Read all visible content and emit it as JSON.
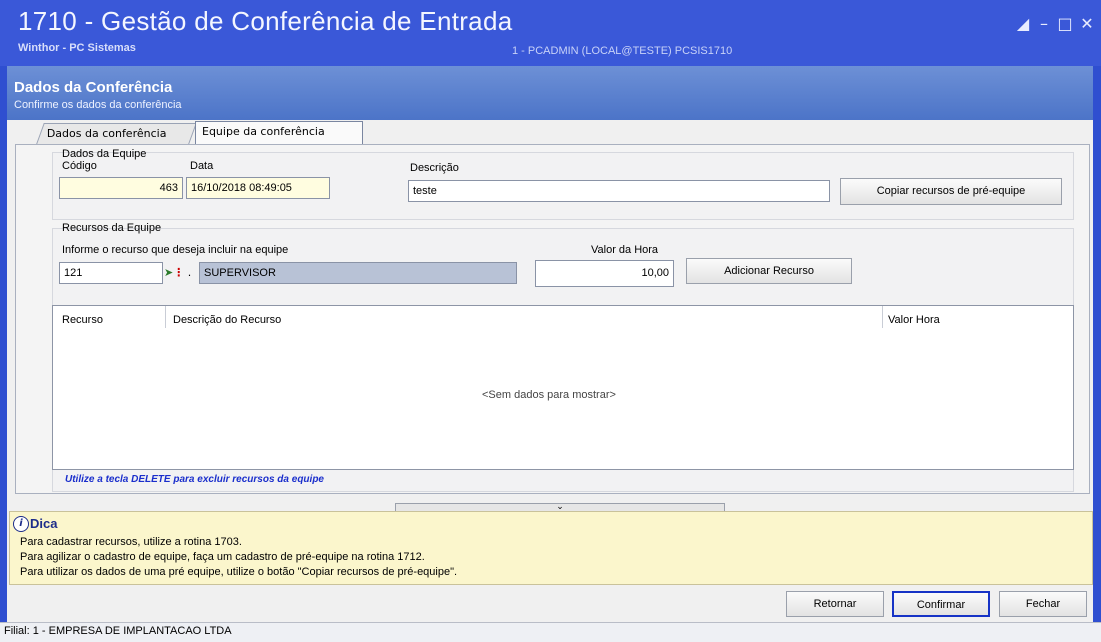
{
  "window": {
    "title": "1710 - Gestão de Conferência de Entrada",
    "subtitle": "Winthor - PC Sistemas",
    "user_info": "1 - PCADMIN (LOCAL@TESTE)   PCSIS1710",
    "controls": [
      "restore-icon",
      "minimize-icon",
      "maximize-icon",
      "close-icon"
    ]
  },
  "header": {
    "title": "Dados da Conferência",
    "subtitle": "Confirme os dados da conferência"
  },
  "tabs": [
    {
      "label": "Dados da conferência",
      "active": false
    },
    {
      "label": "Equipe da conferência",
      "active": true
    }
  ],
  "team": {
    "group_title": "Dados da Equipe",
    "code_label": "Código",
    "code_value": "463",
    "date_label": "Data",
    "date_value": "16/10/2018 08:49:05",
    "description_label": "Descrição",
    "description_value": "teste",
    "copy_button": "Copiar recursos de pré-equipe"
  },
  "resources": {
    "group_title": "Recursos da Equipe",
    "inform_label": "Informe o recurso que deseja incluir na equipe",
    "resource_code": "121",
    "resource_name": "SUPERVISOR",
    "hour_value_label": "Valor da Hora",
    "hour_value": "10,00",
    "add_button": "Adicionar Recurso",
    "columns": [
      "Recurso",
      "Descrição do Recurso",
      "Valor Hora"
    ],
    "empty_text": "<Sem dados para mostrar>",
    "delete_hint": "Utilize a tecla DELETE para excluir recursos da equipe"
  },
  "tip": {
    "title": "Dica",
    "lines": [
      "Para cadastrar recursos, utilize a rotina 1703.",
      "Para agilizar o cadastro de equipe, faça um cadastro de pré-equipe na rotina 1712.",
      "Para utilizar os dados de uma pré equipe, utilize o botão \"Copiar recursos de pré-equipe\"."
    ]
  },
  "footer": {
    "return_button": "Retornar",
    "confirm_button": "Confirmar",
    "close_button": "Fechar"
  },
  "status_bar": {
    "text": "Filial: 1 - EMPRESA DE IMPLANTACAO LTDA"
  },
  "colors": {
    "title_bar": "#3a58d8",
    "header": "#4c74c8",
    "tip_background": "#fbf6cc",
    "hint_text": "#1a2ecc"
  }
}
